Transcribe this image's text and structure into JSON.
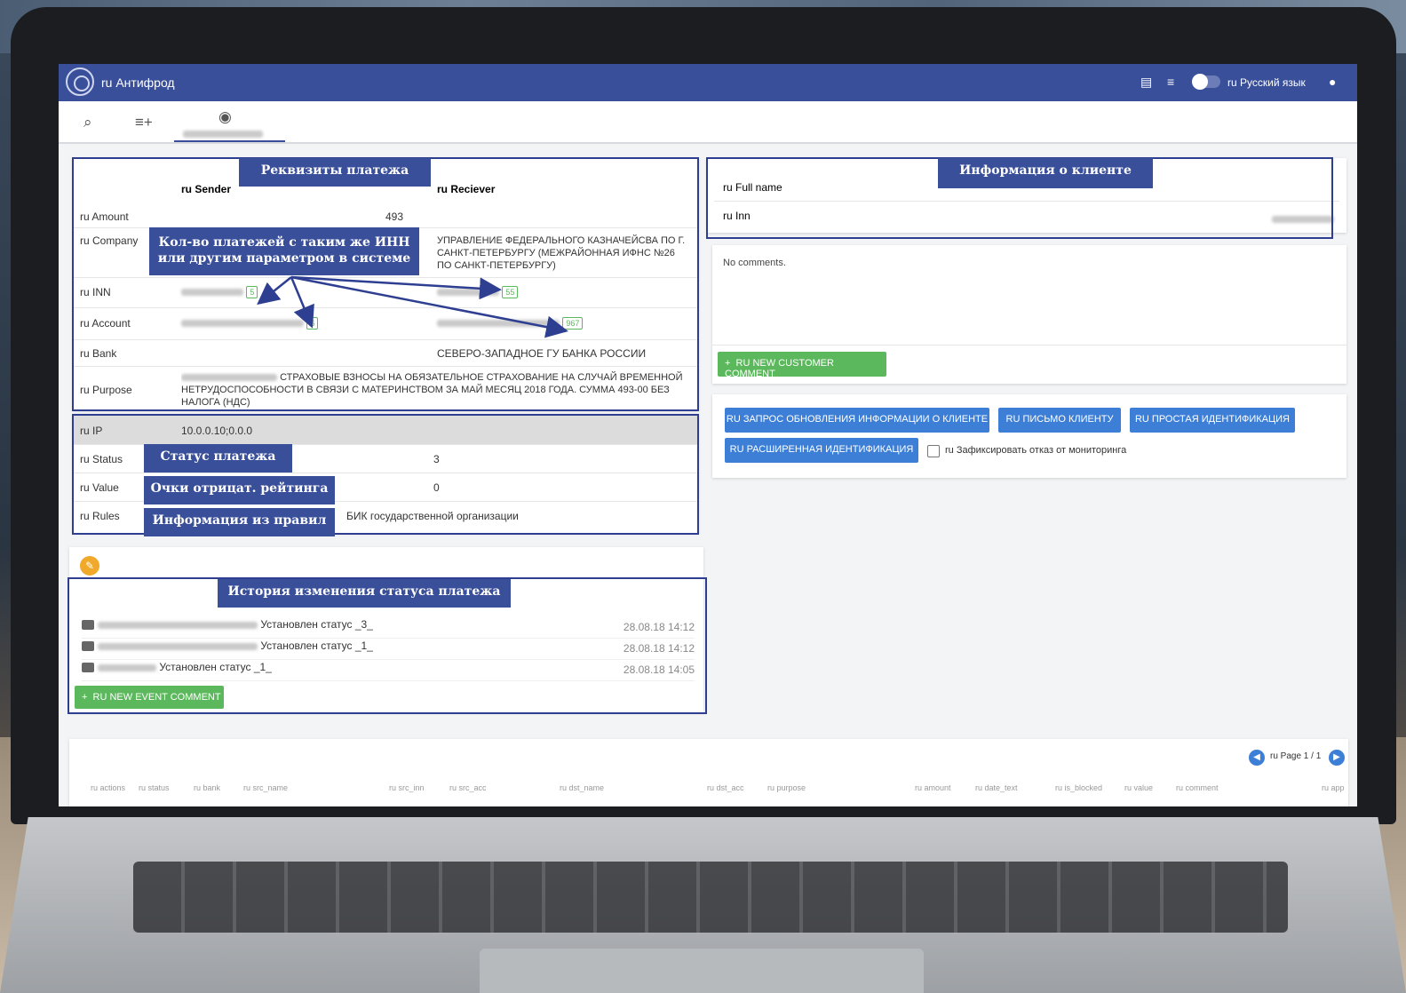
{
  "app": {
    "title": "ru Антифрод",
    "language": "ru Русский язык"
  },
  "payment": {
    "sender_header": "ru Sender",
    "receiver_header": "ru Reciever",
    "rows": {
      "amount": {
        "label": "ru Amount",
        "value": "493"
      },
      "company": {
        "label": "ru Company",
        "receiver": "УПРАВЛЕНИЕ ФЕДЕРАЛЬНОГО КАЗНАЧЕЙСВА ПО Г. САНКТ-ПЕТЕРБУРГУ (МЕЖРАЙОННАЯ ИФНС №26 ПО САНКТ-ПЕТЕРБУРГУ)"
      },
      "inn": {
        "label": "ru INN",
        "sender_count": "5",
        "receiver_count": "55"
      },
      "account": {
        "label": "ru Account",
        "sender_count": "6",
        "receiver_count": "967"
      },
      "bank": {
        "label": "ru Bank",
        "receiver": "СЕВЕРО-ЗАПАДНОЕ ГУ БАНКА РОССИИ"
      },
      "purpose": {
        "label": "ru Purpose",
        "value": "СТРАХОВЫЕ ВЗНОСЫ НА ОБЯЗАТЕЛЬНОЕ СТРАХОВАНИЕ НА СЛУЧАЙ ВРЕМЕННОЙ НЕТРУДОСПОСОБНОСТИ В СВЯЗИ С МАТЕРИНСТВОМ ЗА МАЙ МЕСЯЦ 2018 ГОДА. СУММА 493-00 БЕЗ НАЛОГА (НДС)"
      }
    }
  },
  "status": {
    "ip": {
      "label": "ru IP",
      "value": "10.0.0.10;0.0.0"
    },
    "status": {
      "label": "ru Status",
      "value": "3"
    },
    "value": {
      "label": "ru Value",
      "value": "0"
    },
    "rules": {
      "label": "ru Rules",
      "value": "БИК государственной организации"
    }
  },
  "client": {
    "full_name_label": "ru Full name",
    "inn_label": "ru Inn",
    "no_comments": "No comments.",
    "new_comment": "RU NEW CUSTOMER COMMENT"
  },
  "actions": {
    "update_info": "RU ЗАПРОС ОБНОВЛЕНИЯ ИНФОРМАЦИИ О КЛИЕНТЕ",
    "letter": "RU ПИСЬМО КЛИЕНТУ",
    "simple_id": "RU ПРОСТАЯ ИДЕНТИФИКАЦИЯ",
    "extended_id": "RU РАСШИРЕННАЯ ИДЕНТИФИКАЦИЯ",
    "refuse_monitoring": "ru Зафиксировать отказ от мониторинга"
  },
  "history": {
    "rows": [
      {
        "text": "Установлен статус _3_",
        "time": "28.08.18 14:12"
      },
      {
        "text": "Установлен статус _1_",
        "time": "28.08.18 14:12"
      },
      {
        "text": "Установлен статус _1_",
        "time": "28.08.18 14:05"
      }
    ],
    "new_event": "RU NEW EVENT COMMENT"
  },
  "pager": {
    "page": "ru Page 1 / 1"
  },
  "table_columns": [
    "ru actions",
    "ru status",
    "ru bank",
    "ru src_name",
    "ru src_inn",
    "ru src_acc",
    "ru dst_name",
    "ru dst_acc",
    "ru purpose",
    "ru amount",
    "ru date_text",
    "ru is_blocked",
    "ru value",
    "ru comment",
    "ru app"
  ],
  "annotations": {
    "payment_details": "Реквизиты платежа",
    "client_info": "Информация о клиенте",
    "count_same_inn_line1": "Кол-во платежей с таким же ИНН",
    "count_same_inn_line2": "или другим параметром в системе",
    "payment_status": "Статус платежа",
    "negative_rating": "Очки отрицат. рейтинга",
    "rules_info": "Информация из правил",
    "status_history": "История изменения статуса платежа"
  },
  "colors": {
    "appbar": "#3a4f9a",
    "annotation": "#2e3f91",
    "primary_button": "#3d7fd6",
    "success_button": "#5cb85c"
  }
}
